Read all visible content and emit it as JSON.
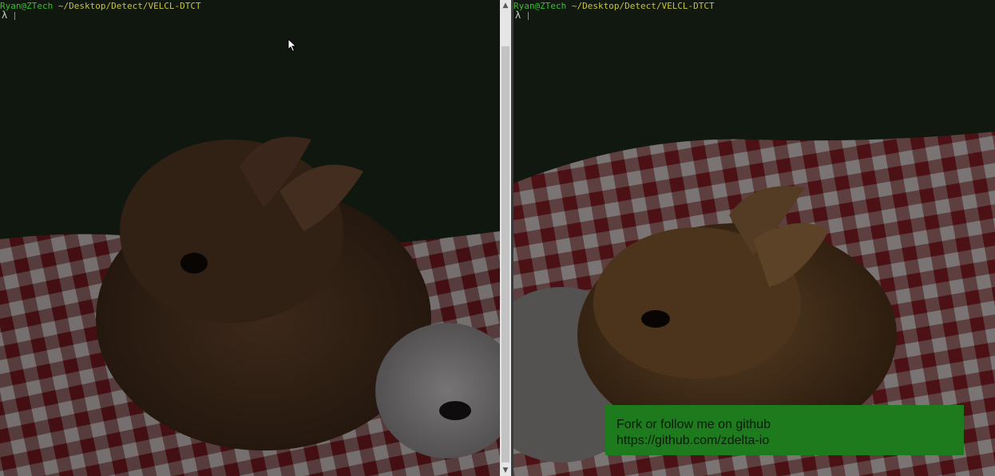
{
  "terminal": {
    "panes": [
      {
        "id": "left",
        "prompt_user": "Ryan@ZTech",
        "prompt_path": "~/Desktop/Detect/VELCL-DTCT",
        "prompt_symbol": "λ"
      },
      {
        "id": "right",
        "prompt_user": "Ryan@ZTech",
        "prompt_path": "~/Desktop/Detect/VELCL-DTCT",
        "prompt_symbol": "λ"
      }
    ],
    "scrollbar": {
      "up_arrow": "▲",
      "down_arrow": "▼"
    }
  },
  "overlay": {
    "line1": "Fork or follow me on github",
    "line2": "https://github.com/zdelta-io"
  },
  "colors": {
    "prompt_user": "#39c02f",
    "prompt_path": "#c8c43a",
    "overlay_bg": "#1d7a1d"
  }
}
